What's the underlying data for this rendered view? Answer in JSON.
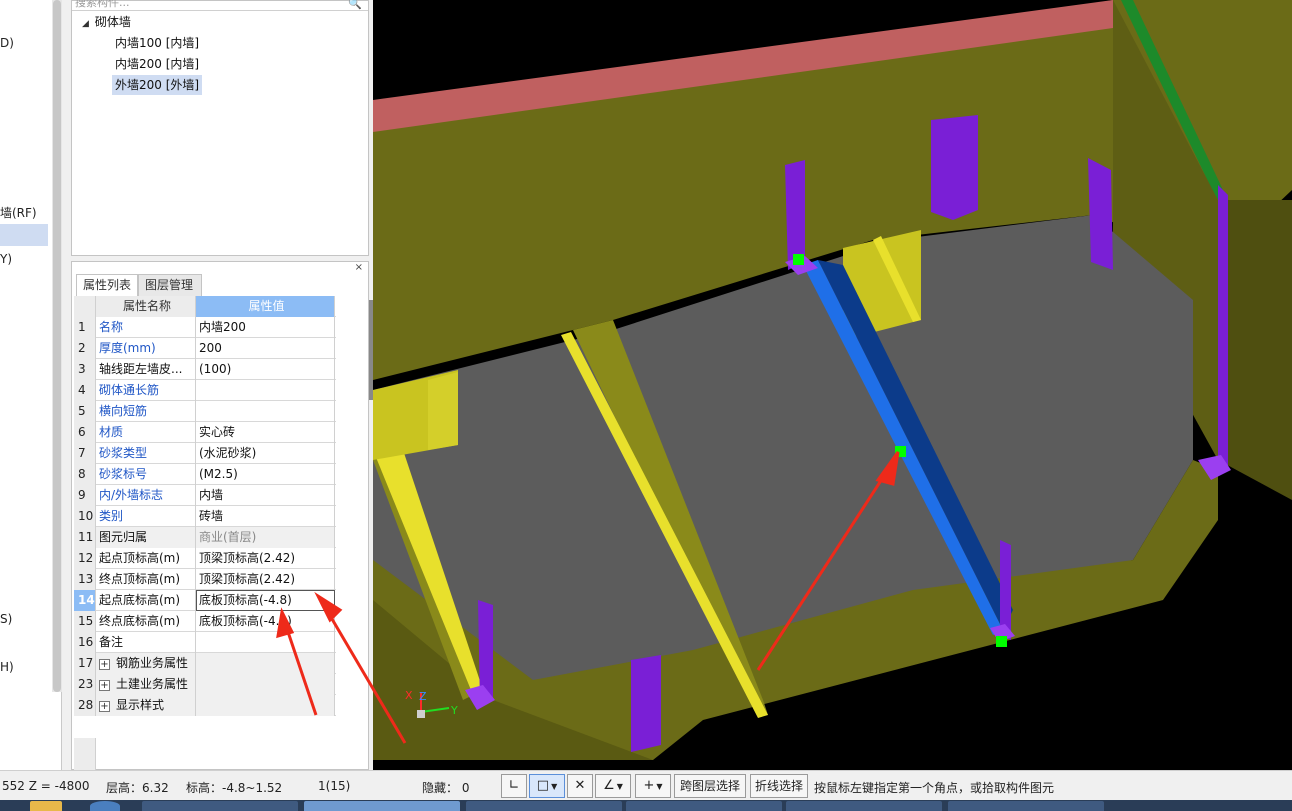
{
  "left_tree_fragments": [
    "D)",
    "墙(RF)",
    "Y)",
    "S)",
    "H)"
  ],
  "component_tree": {
    "search_placeholder": "搜索构件...",
    "root_label": "砌体墙",
    "items": [
      {
        "label": "内墙100 [内墙]",
        "selected": false
      },
      {
        "label": "内墙200 [内墙]",
        "selected": false
      },
      {
        "label": "外墙200 [外墙]",
        "selected": true
      }
    ]
  },
  "properties": {
    "close_label": "×",
    "tabs": [
      {
        "label": "属性列表",
        "active": true
      },
      {
        "label": "图层管理",
        "active": false
      }
    ],
    "header": {
      "name": "属性名称",
      "value": "属性值"
    },
    "rows": [
      {
        "num": "1",
        "name": "名称",
        "value": "内墙200",
        "blue": true
      },
      {
        "num": "2",
        "name": "厚度(mm)",
        "value": "200",
        "blue": true
      },
      {
        "num": "3",
        "name": "轴线距左墙皮...",
        "value": "(100)",
        "blue": false
      },
      {
        "num": "4",
        "name": "砌体通长筋",
        "value": "",
        "blue": true
      },
      {
        "num": "5",
        "name": "横向短筋",
        "value": "",
        "blue": true
      },
      {
        "num": "6",
        "name": "材质",
        "value": "实心砖",
        "blue": true
      },
      {
        "num": "7",
        "name": "砂浆类型",
        "value": "(水泥砂浆)",
        "blue": true
      },
      {
        "num": "8",
        "name": "砂浆标号",
        "value": "(M2.5)",
        "blue": true
      },
      {
        "num": "9",
        "name": "内/外墙标志",
        "value": "内墙",
        "blue": true
      },
      {
        "num": "10",
        "name": "类别",
        "value": "砖墙",
        "blue": true
      },
      {
        "num": "11",
        "name": "图元归属",
        "value": "商业(首层)",
        "blue": false,
        "gray": true
      },
      {
        "num": "12",
        "name": "起点顶标高(m)",
        "value": "顶梁顶标高(2.42)",
        "blue": false
      },
      {
        "num": "13",
        "name": "终点顶标高(m)",
        "value": "顶梁顶标高(2.42)",
        "blue": false
      },
      {
        "num": "14",
        "name": "起点底标高(m)",
        "value": "底板顶标高(-4.8)",
        "blue": false,
        "selected": true
      },
      {
        "num": "15",
        "name": "终点底标高(m)",
        "value": "底板顶标高(-4.8)",
        "blue": false
      },
      {
        "num": "16",
        "name": "备注",
        "value": "",
        "blue": false
      },
      {
        "num": "17",
        "name": "钢筋业务属性",
        "value": "",
        "blue": false,
        "group": true
      },
      {
        "num": "23",
        "name": "土建业务属性",
        "value": "",
        "blue": false,
        "group": true
      },
      {
        "num": "28",
        "name": "显示样式",
        "value": "",
        "blue": false,
        "group": true
      }
    ]
  },
  "viewport": {
    "axis_labels": {
      "x": "X",
      "y": "Y",
      "z": "Z"
    },
    "colors": {
      "background": "#000000",
      "slab": "#5c5c5c",
      "wall": "#8a8a1a",
      "wall_dark": "#5a5a12",
      "yellow_beam": "#e8e02c",
      "purple_column": "#7a1fd6",
      "selected_wall": "#1f6fe8",
      "grip_point": "#00ff00",
      "arrow": "#ee2a1a",
      "top_red_edge": "#c06060",
      "top_green_edge": "#1d8a2a"
    }
  },
  "status_bar": {
    "coords": "552 Z = -4800",
    "floor_height": "层高：6.32",
    "elevation": "标高：-4.8~1.52",
    "count": "1(15)",
    "hidden": "隐藏： 0",
    "btn_cross_layer": "跨图层选择",
    "btn_polyline": "折线选择",
    "hint": "按鼠标左键指定第一个角点，或拾取构件图元"
  }
}
